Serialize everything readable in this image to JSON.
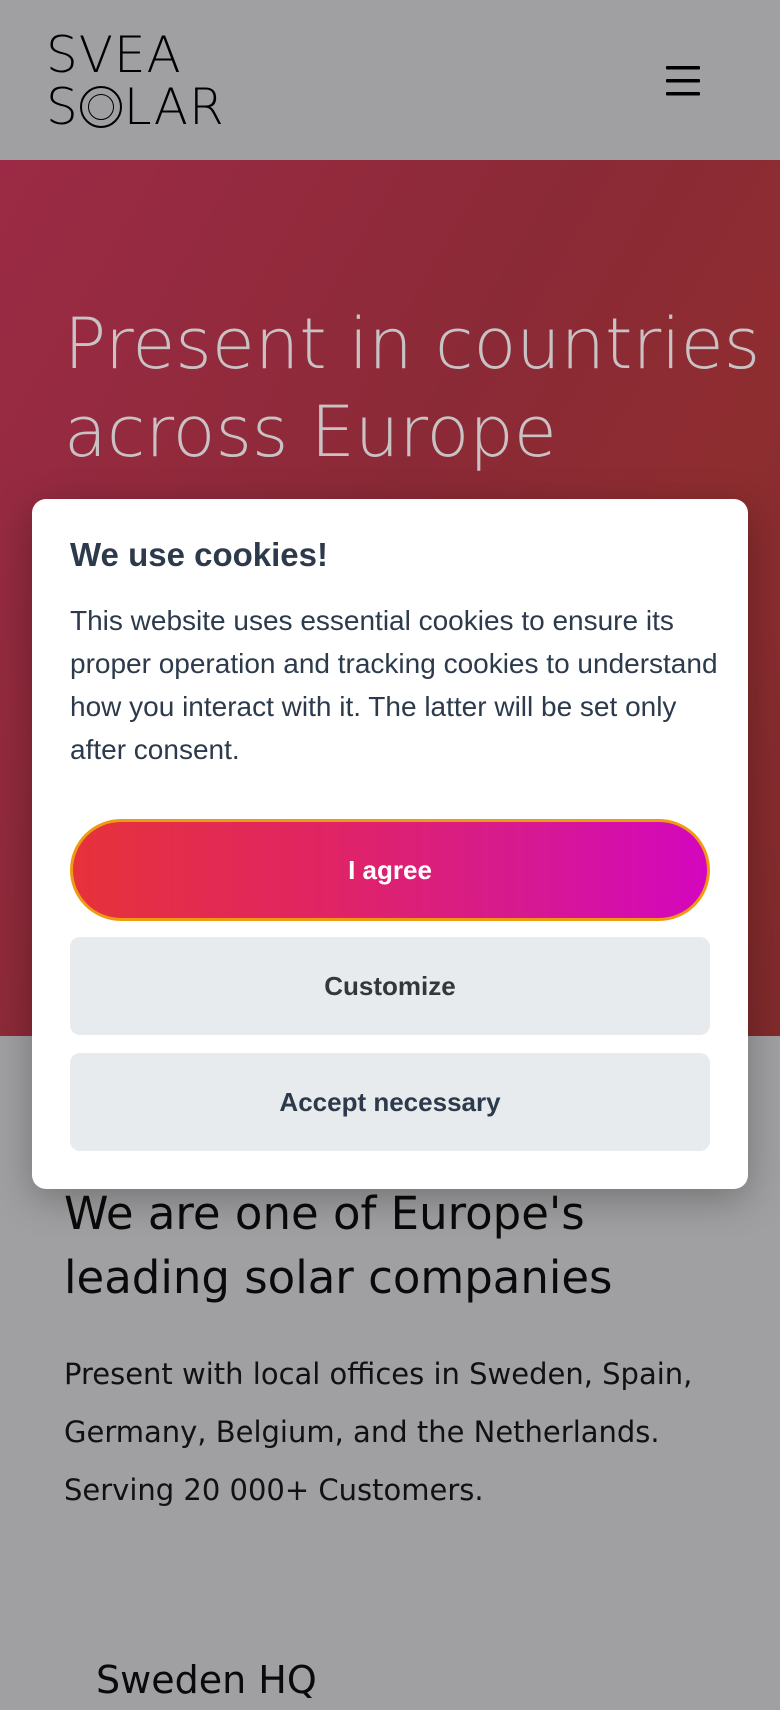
{
  "header": {
    "logo_line_1": "SVEA",
    "logo_line_2_start": "S",
    "logo_line_2_end": "LAR",
    "menu_icon": "hamburger-menu-icon"
  },
  "hero": {
    "title": "Present in countries across Europe"
  },
  "cookie_dialog": {
    "title": "We use cookies!",
    "text": "This website uses essential cookies to ensure its proper operation and tracking cookies to understand how you interact with it. The latter will be set only after consent.",
    "agree_label": "I agree",
    "customize_label": "Customize",
    "necessary_label": "Accept necessary"
  },
  "about": {
    "heading": "We are one of Europe's leading solar companies",
    "text": "Present with local offices in Sweden, Spain, Germany, Belgium, and the Netherlands. Serving 20 000+ Customers."
  },
  "hq": {
    "heading": "Sweden HQ"
  },
  "colors": {
    "hero_red": "#8a1420",
    "dialog_text": "#2c3a4b",
    "agree_gradient_start": "#e6323a",
    "agree_gradient_end": "#d406be",
    "agree_border": "#f09a12",
    "secondary_button_bg": "#e8ebee",
    "overlay_gray": "#a0a0a2"
  }
}
